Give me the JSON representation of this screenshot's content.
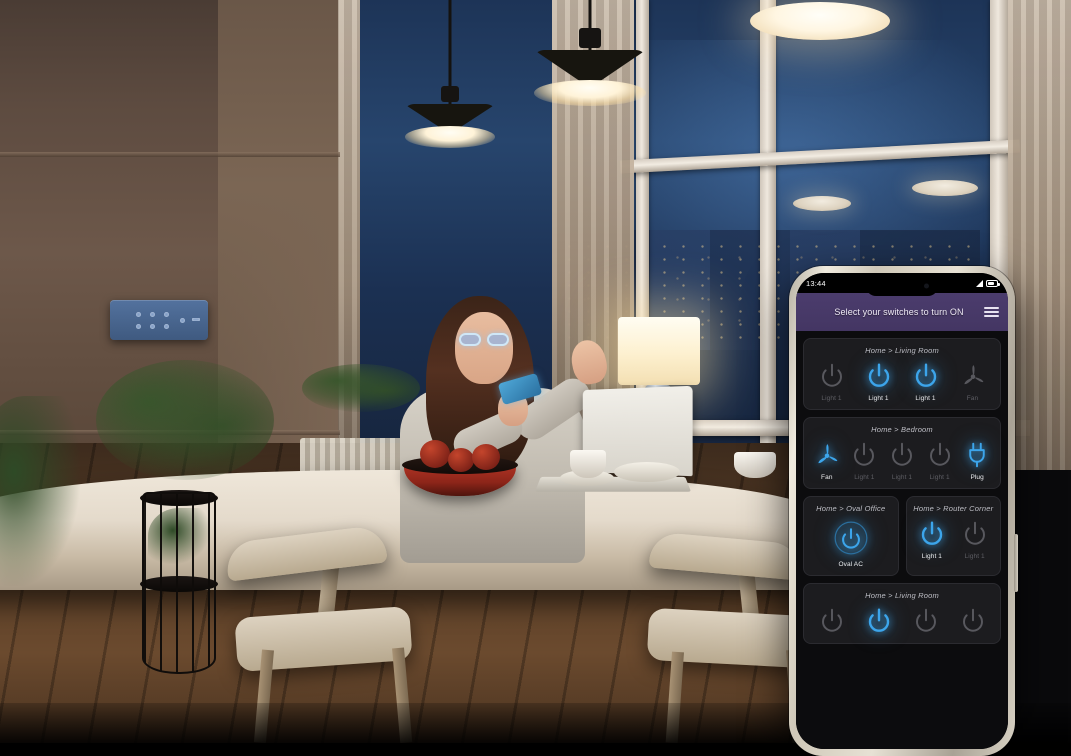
{
  "scene": {
    "description": "Dim evening dining room with woman using smartphone at table",
    "wall_switch_panel": "wall-switch-panel"
  },
  "phone": {
    "status_bar": {
      "time": "13:44",
      "signal_icon": "signal-triangle-icon",
      "battery_icon": "battery-icon"
    },
    "header": {
      "title": "Select your switches to turn ON",
      "menu_icon": "hamburger-menu-icon",
      "background_color": "#4b3c6d"
    },
    "colors": {
      "on": "#3ca5eb",
      "off": "#6a6a70",
      "card_bg": "#1c1c1f",
      "app_bg": "#0c0c0e"
    },
    "cards": [
      {
        "title": "Home > Living Room",
        "layout": "full",
        "switches": [
          {
            "label": "Light 1",
            "icon": "power-icon",
            "state": "off"
          },
          {
            "label": "Light 1",
            "icon": "power-icon",
            "state": "on"
          },
          {
            "label": "Light 1",
            "icon": "power-icon",
            "state": "on"
          },
          {
            "label": "Fan",
            "icon": "fan-icon",
            "state": "off"
          }
        ]
      },
      {
        "title": "Home > Bedroom",
        "layout": "full",
        "switches": [
          {
            "label": "Fan",
            "icon": "fan-icon",
            "state": "on"
          },
          {
            "label": "Light 1",
            "icon": "power-icon",
            "state": "off"
          },
          {
            "label": "Light 1",
            "icon": "power-icon",
            "state": "off"
          },
          {
            "label": "Light 1",
            "icon": "power-icon",
            "state": "off"
          },
          {
            "label": "Plug",
            "icon": "plug-icon",
            "state": "on"
          }
        ]
      },
      {
        "title": "Home > Oval Office",
        "layout": "half",
        "switches": [
          {
            "label": "Oval AC",
            "icon": "power-circle-icon",
            "state": "on"
          }
        ]
      },
      {
        "title": "Home > Router Corner",
        "layout": "half",
        "switches": [
          {
            "label": "Light 1",
            "icon": "power-icon",
            "state": "on"
          },
          {
            "label": "Light 1",
            "icon": "power-icon",
            "state": "off"
          }
        ]
      },
      {
        "title": "Home > Living Room",
        "layout": "full",
        "switches": [
          {
            "label": "",
            "icon": "power-icon",
            "state": "off"
          },
          {
            "label": "",
            "icon": "power-icon",
            "state": "on"
          },
          {
            "label": "",
            "icon": "power-icon",
            "state": "off"
          },
          {
            "label": "",
            "icon": "power-icon",
            "state": "off"
          }
        ]
      }
    ]
  }
}
